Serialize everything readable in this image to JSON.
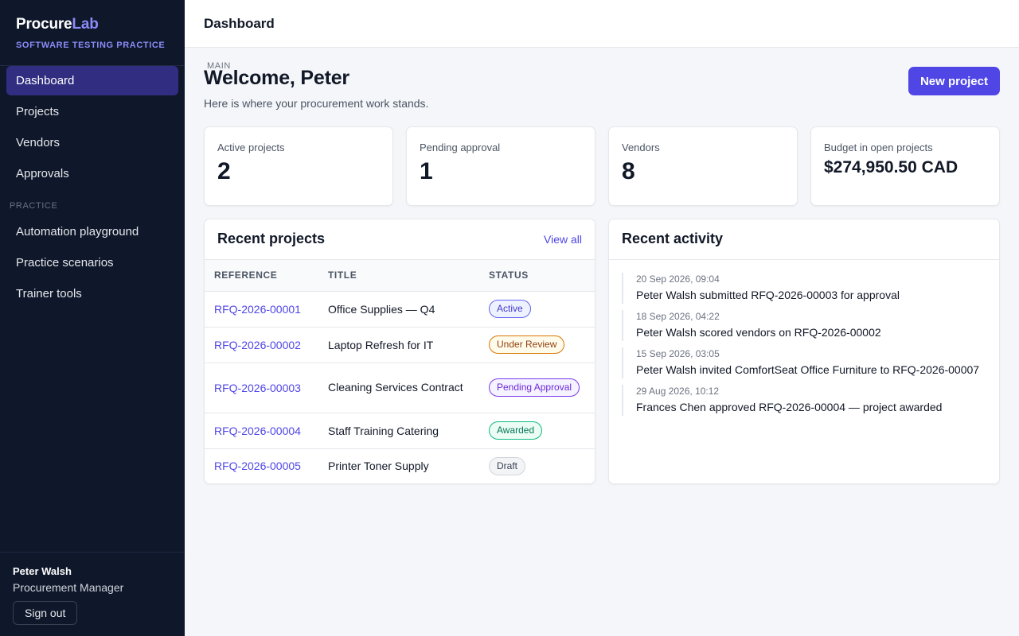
{
  "brand": {
    "name_part1": "Procure",
    "name_part2": "Lab",
    "subtitle": "SOFTWARE TESTING PRACTICE"
  },
  "sidebar": {
    "main_heading": "MAIN",
    "main_items": [
      {
        "label": "Dashboard",
        "active": true
      },
      {
        "label": "Projects"
      },
      {
        "label": "Vendors"
      },
      {
        "label": "Approvals"
      }
    ],
    "practice_heading": "PRACTICE",
    "practice_items": [
      {
        "label": "Automation playground"
      },
      {
        "label": "Practice scenarios"
      },
      {
        "label": "Trainer tools"
      }
    ],
    "user": {
      "name": "Peter Walsh",
      "role": "Procurement Manager"
    },
    "signout_label": "Sign out"
  },
  "topbar": {
    "title": "Dashboard"
  },
  "main": {
    "welcome": "Welcome, Peter",
    "subtitle": "Here is where your procurement work stands.",
    "new_project_label": "New project",
    "stats": [
      {
        "label": "Active projects",
        "value": "2"
      },
      {
        "label": "Pending approval",
        "value": "1"
      },
      {
        "label": "Vendors",
        "value": "8"
      },
      {
        "label": "Budget in open projects",
        "value": "$274,950.50 CAD"
      }
    ],
    "recent_projects": {
      "title": "Recent projects",
      "view_all": "View all",
      "columns": [
        "REFERENCE",
        "TITLE",
        "STATUS"
      ],
      "rows": [
        {
          "ref": "RFQ-2026-00001",
          "title": "Office Supplies — Q4",
          "status": "Active"
        },
        {
          "ref": "RFQ-2026-00002",
          "title": "Laptop Refresh for IT",
          "status": "Under Review"
        },
        {
          "ref": "RFQ-2026-00003",
          "title": "Cleaning Services Contract",
          "status": "Pending Approval"
        },
        {
          "ref": "RFQ-2026-00004",
          "title": "Staff Training Catering",
          "status": "Awarded"
        },
        {
          "ref": "RFQ-2026-00005",
          "title": "Printer Toner Supply",
          "status": "Draft"
        }
      ]
    },
    "recent_activity": {
      "title": "Recent activity",
      "items": [
        {
          "time": "20 Sep 2026, 09:04",
          "text": "Peter Walsh submitted RFQ-2026-00003 for approval"
        },
        {
          "time": "18 Sep 2026, 04:22",
          "text": "Peter Walsh scored vendors on RFQ-2026-00002"
        },
        {
          "time": "15 Sep 2026, 03:05",
          "text": "Peter Walsh invited ComfortSeat Office Furniture to RFQ-2026-00007"
        },
        {
          "time": "29 Aug 2026, 10:12",
          "text": "Frances Chen approved RFQ-2026-00004 — project awarded"
        }
      ]
    }
  },
  "colors": {
    "sidebar_bg": "#0f172a",
    "accent": "#4f46e5",
    "active_nav": "#312e81",
    "brand_accent": "#8b8cf8"
  }
}
